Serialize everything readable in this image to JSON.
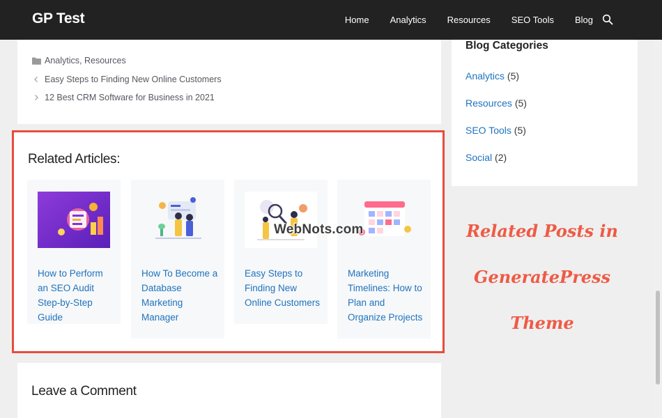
{
  "header": {
    "logo": "GP Test",
    "nav": [
      {
        "label": "Home"
      },
      {
        "label": "Analytics"
      },
      {
        "label": "Resources"
      },
      {
        "label": "SEO Tools"
      },
      {
        "label": "Blog"
      }
    ],
    "search_icon": "search-icon"
  },
  "post_meta": {
    "categories": "Analytics, Resources",
    "prev_post": "Easy Steps to Finding New Online Customers",
    "next_post": "12 Best CRM Software for Business in 2021"
  },
  "related": {
    "title": "Related Articles:",
    "cards": [
      {
        "title": "How to Perform an SEO Audit Step-by-Step Guide"
      },
      {
        "title": "How To Become a Database Marketing Manager"
      },
      {
        "title": "Easy Steps to Finding New Online Customers"
      },
      {
        "title": "Marketing Timelines: How to Plan and Organize Projects"
      }
    ],
    "highlight_color": "#e74c3c"
  },
  "sidebar": {
    "title": "Blog Categories",
    "items": [
      {
        "label": "Analytics",
        "count": "(5)"
      },
      {
        "label": "Resources",
        "count": "(5)"
      },
      {
        "label": "SEO Tools",
        "count": "(5)"
      },
      {
        "label": "Social",
        "count": "(2)"
      }
    ]
  },
  "promo": {
    "line1": "Related Posts in",
    "line2": "GeneratePress",
    "line3": "Theme"
  },
  "watermark": "WebNots.com",
  "comments": {
    "title": "Leave a Comment"
  },
  "colors": {
    "header_bg": "#222222",
    "link": "#1e73be",
    "promo": "#ee5b45"
  }
}
